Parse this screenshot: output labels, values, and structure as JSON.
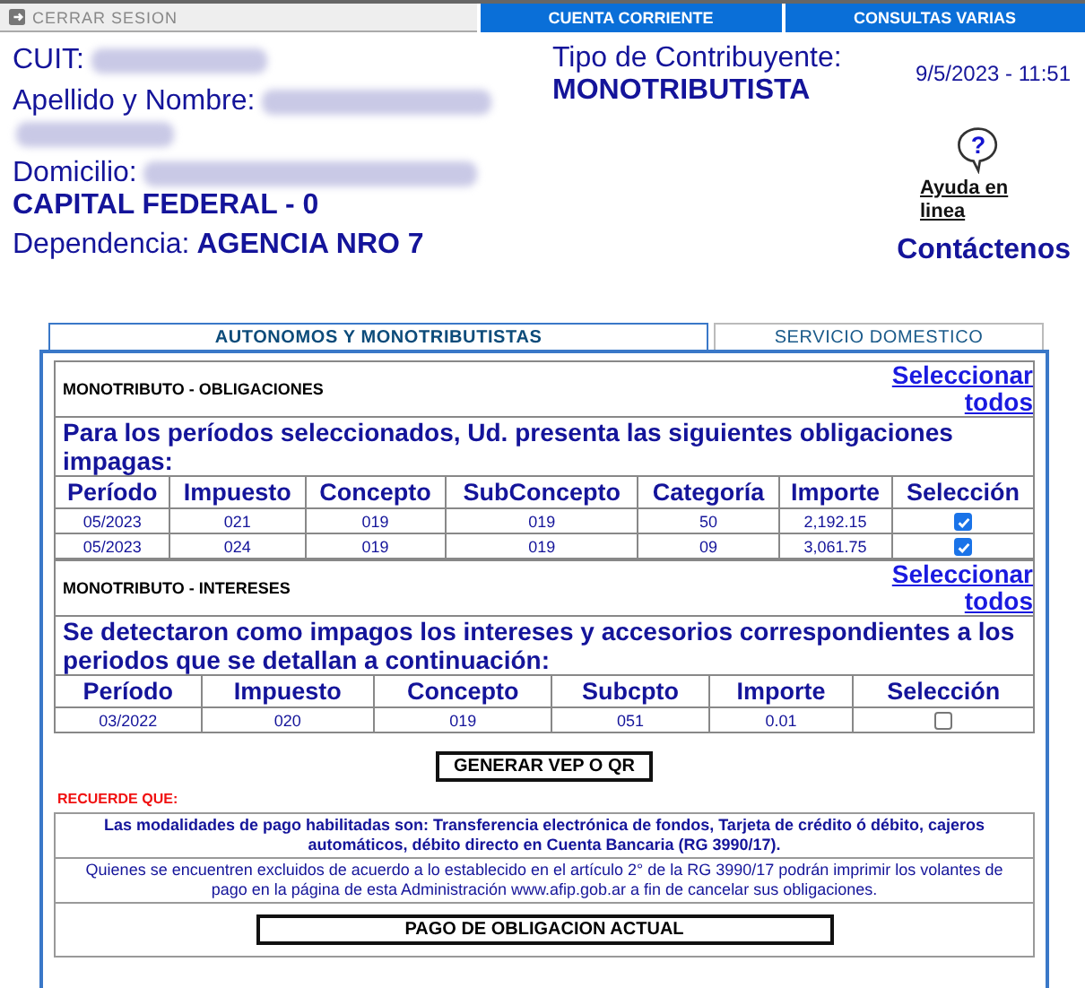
{
  "nav": [
    {
      "label": "CERRAR SESION",
      "kind": "logout"
    },
    {
      "label": "CUENTA CORRIENTE",
      "kind": "menu"
    },
    {
      "label": "CONSULTAS VARIAS",
      "kind": "menu"
    }
  ],
  "taxpayer": {
    "cuit_label": "CUIT:",
    "name_label": "Apellido y Nombre:",
    "address_label": "Domicilio:",
    "address_line2": "CAPITAL FEDERAL - 0",
    "dependency_label": "Dependencia:",
    "dependency": "AGENCIA NRO 7",
    "type_label": "Tipo de Contribuyente:",
    "type": "MONOTRIBUTISTA",
    "datetime": "9/5/2023 - 11:51"
  },
  "help_icon": "?",
  "help_link": "Ayuda en linea",
  "contact_link": "Contáctenos",
  "tabs": [
    {
      "label": "AUTONOMOS Y MONOTRIBUTISTAS",
      "selected": true
    },
    {
      "label": "SERVICIO DOMESTICO",
      "selected": false
    }
  ],
  "sections": [
    {
      "title": "MONOTRIBUTO - OBLIGACIONES",
      "select_all": "Seleccionar todos",
      "message": "Para los períodos seleccionados, Ud. presenta las siguientes obligaciones impagas:",
      "columns": [
        "Período",
        "Impuesto",
        "Concepto",
        "SubConcepto",
        "Categoría",
        "Importe",
        "Selección"
      ],
      "rows": [
        {
          "cells": [
            "05/2023",
            "021",
            "019",
            "019",
            "50",
            "2,192.15"
          ],
          "selected": true
        },
        {
          "cells": [
            "05/2023",
            "024",
            "019",
            "019",
            "09",
            "3,061.75"
          ],
          "selected": true
        }
      ]
    },
    {
      "title": "MONOTRIBUTO - INTERESES",
      "select_all": "Seleccionar todos",
      "message": "Se detectaron como impagos los intereses y accesorios correspondientes a los periodos que se detallan a continuación:",
      "columns": [
        "Período",
        "Impuesto",
        "Concepto",
        "Subcpto",
        "Importe",
        "Selección"
      ],
      "rows": [
        {
          "cells": [
            "03/2022",
            "020",
            "019",
            "051",
            "0.01"
          ],
          "selected": false
        }
      ]
    }
  ],
  "generate_button": "GENERAR VEP O QR",
  "notice_title": "RECUERDE QUE:",
  "notices": [
    {
      "text": "Las modalidades de pago habilitadas son: Transferencia electrónica de fondos, Tarjeta de crédito ó débito, cajeros automáticos, débito directo en Cuenta Bancaria (RG 3990/17).",
      "kind": "strong"
    },
    {
      "text": "Quienes se encuentren excluidos de acuerdo a lo establecido en el artículo 2° de la RG 3990/17 podrán imprimir los volantes de pago en la página de esta Administración www.afip.gob.ar a fin de cancelar sus obligaciones.",
      "kind": "plain"
    }
  ],
  "bottom_button": "PAGO DE OBLIGACION ACTUAL"
}
